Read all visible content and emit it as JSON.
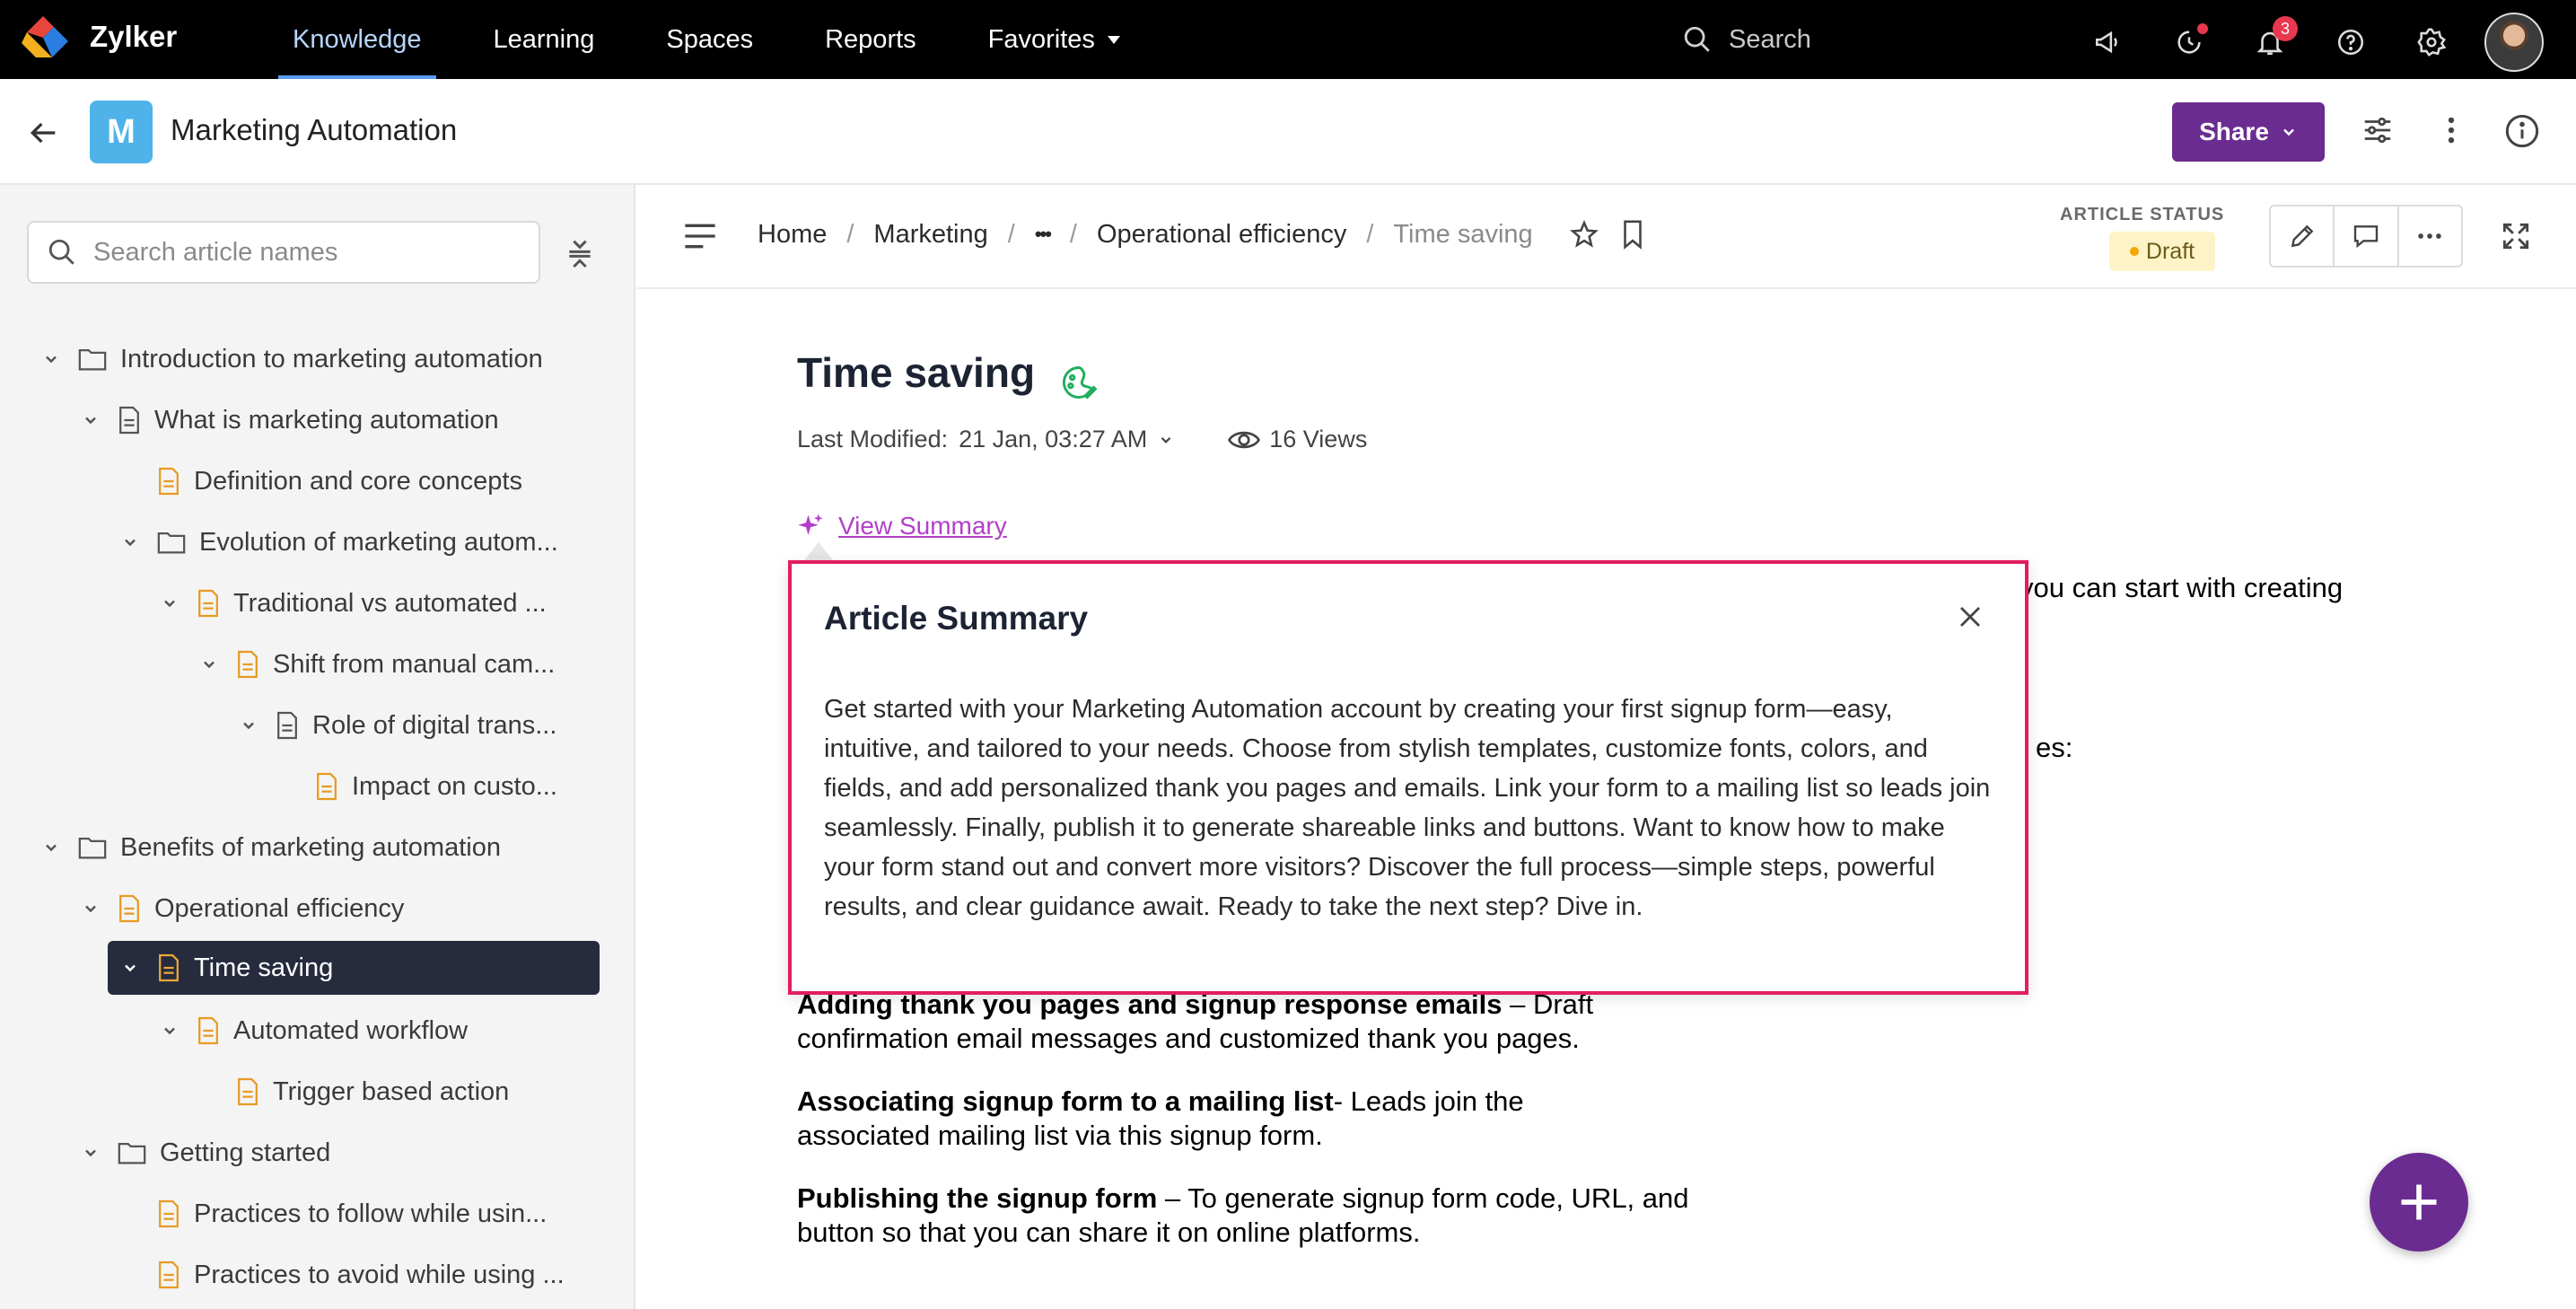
{
  "app": {
    "brand": "Zylker"
  },
  "nav": {
    "items": [
      {
        "label": "Knowledge"
      },
      {
        "label": "Learning"
      },
      {
        "label": "Spaces"
      },
      {
        "label": "Reports"
      },
      {
        "label": "Favorites"
      }
    ],
    "active": "Knowledge"
  },
  "search": {
    "placeholder": "Search"
  },
  "notifications": {
    "count": "3"
  },
  "header": {
    "block_letter": "M",
    "title": "Marketing Automation",
    "share_label": "Share"
  },
  "sidebar": {
    "search_placeholder": "Search article names",
    "tree": [
      {
        "label": "Introduction to marketing automation"
      },
      {
        "label": "What is marketing automation"
      },
      {
        "label": "Definition and core concepts"
      },
      {
        "label": "Evolution of marketing autom..."
      },
      {
        "label": "Traditional vs automated ..."
      },
      {
        "label": "Shift from manual cam..."
      },
      {
        "label": "Role of digital trans..."
      },
      {
        "label": "Impact on custo..."
      },
      {
        "label": "Benefits of marketing automation"
      },
      {
        "label": "Operational efficiency"
      },
      {
        "label": "Time saving"
      },
      {
        "label": "Automated workflow"
      },
      {
        "label": "Trigger based action"
      },
      {
        "label": "Getting started"
      },
      {
        "label": "Practices to follow while usin..."
      },
      {
        "label": "Practices to avoid while using ..."
      }
    ]
  },
  "breadcrumb": {
    "home": "Home",
    "marketing": "Marketing",
    "ellipsis": "•••",
    "operational": "Operational efficiency",
    "current": "Time saving"
  },
  "status": {
    "label": "ARTICLE STATUS",
    "value": "Draft"
  },
  "article": {
    "title": "Time saving",
    "last_modified_label": "Last Modified:",
    "last_modified_value": "21 Jan, 03:27 AM",
    "views": "16 Views",
    "view_summary": "View Summary",
    "peek1": "you can start with creating",
    "peek2": "es:",
    "p1_bold": "Adding thank you pages and signup response emails",
    "p1_rest1": " – Draft",
    "p1_rest2": "confirmation email messages and customized thank you pages.",
    "p2_bold": "Associating signup form to a mailing list",
    "p2_rest1": "-  Leads join the",
    "p2_rest2": "associated mailing list via this signup form.",
    "p3_bold": "Publishing the signup form",
    "p3_rest1": " – To generate signup form code, URL, and",
    "p3_rest2": "button so that you can share it on online platforms."
  },
  "summary": {
    "title": "Article Summary",
    "body": "Get started with your Marketing Automation account by creating your first signup form—easy, intuitive, and tailored to your needs. Choose from stylish templates, customize fonts, colors, and fields, and add personalized thank you pages and emails. Link your form to a mailing list so leads join seamlessly. Finally, publish it to generate shareable links and buttons. Want to know how to make your form stand out and convert more visitors? Discover the full process—simple steps, powerful results, and clear guidance await. Ready to take the next step? Dive in."
  },
  "colors": {
    "accent": "#6b2c91",
    "highlight_border": "#e21e5e",
    "nav_active": "#5b9cf5",
    "selected_row": "#262b3d"
  }
}
